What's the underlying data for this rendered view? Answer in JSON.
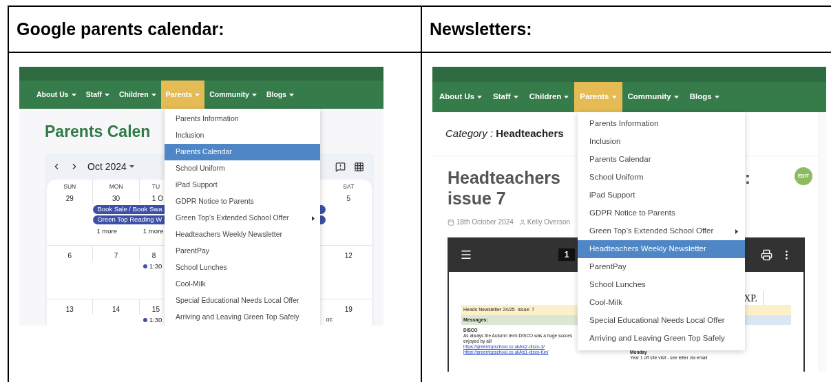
{
  "sections": [
    {
      "heading": "Google parents calendar:",
      "screenshot": {
        "kind": "calendar",
        "nav": [
          {
            "label": "About Us",
            "selected": false
          },
          {
            "label": "Staff",
            "selected": false
          },
          {
            "label": "Children",
            "selected": false
          },
          {
            "label": "Parents",
            "selected": true
          },
          {
            "label": "Community",
            "selected": false
          },
          {
            "label": "Blogs",
            "selected": false
          }
        ],
        "menu": [
          {
            "label": "Parents Information",
            "selected": false,
            "has_submenu": false
          },
          {
            "label": "Inclusion",
            "selected": false,
            "has_submenu": false
          },
          {
            "label": "Parents Calendar",
            "selected": true,
            "has_submenu": false
          },
          {
            "label": "School Uniform",
            "selected": false,
            "has_submenu": false
          },
          {
            "label": "iPad Support",
            "selected": false,
            "has_submenu": false
          },
          {
            "label": "GDPR Notice to Parents",
            "selected": false,
            "has_submenu": false
          },
          {
            "label": "Green Top’s Extended School Offer",
            "selected": false,
            "has_submenu": true
          },
          {
            "label": "Headteachers Weekly Newsletter",
            "selected": false,
            "has_submenu": false
          },
          {
            "label": "ParentPay",
            "selected": false,
            "has_submenu": false
          },
          {
            "label": "School Lunches",
            "selected": false,
            "has_submenu": false
          },
          {
            "label": "Cool-Milk",
            "selected": false,
            "has_submenu": false
          },
          {
            "label": "Special Educational Needs Local Offer",
            "selected": false,
            "has_submenu": false
          },
          {
            "label": "Arriving and Leaving Green Top Safely",
            "selected": false,
            "has_submenu": false
          }
        ],
        "page_title": "Parents Calen",
        "month": "Oct 2024",
        "weekdays": [
          "SUN",
          "MON",
          "TU",
          "SAT"
        ],
        "weeks": [
          {
            "days": [
              {
                "date": "29"
              },
              {
                "date": "30",
                "more": "1 more"
              },
              {
                "date": "1 O",
                "more": "1 more"
              },
              {
                "date": "5"
              }
            ],
            "all_day_events": [
              "Book Sale / Book Swa",
              "Green Top Reading W"
            ]
          },
          {
            "days": [
              {
                "date": "6"
              },
              {
                "date": "7"
              },
              {
                "date": "8",
                "timed_event": "1:30"
              },
              {
                "date": "12"
              }
            ]
          },
          {
            "days": [
              {
                "date": "13"
              },
              {
                "date": "14"
              },
              {
                "date": "15",
                "timed_event": "1:30"
              },
              {
                "date": "19"
              }
            ],
            "cut_event": "oc"
          }
        ]
      }
    },
    {
      "heading": "Newsletters:",
      "screenshot": {
        "kind": "post",
        "nav": [
          {
            "label": "About Us",
            "selected": false
          },
          {
            "label": "Staff",
            "selected": false
          },
          {
            "label": "Children",
            "selected": false
          },
          {
            "label": "Parents",
            "selected": true
          },
          {
            "label": "Community",
            "selected": false
          },
          {
            "label": "Blogs",
            "selected": false
          }
        ],
        "menu": [
          {
            "label": "Parents Information",
            "selected": false,
            "has_submenu": false
          },
          {
            "label": "Inclusion",
            "selected": false,
            "has_submenu": false
          },
          {
            "label": "Parents Calendar",
            "selected": false,
            "has_submenu": false
          },
          {
            "label": "School Uniform",
            "selected": false,
            "has_submenu": false
          },
          {
            "label": "iPad Support",
            "selected": false,
            "has_submenu": false
          },
          {
            "label": "GDPR Notice to Parents",
            "selected": false,
            "has_submenu": false
          },
          {
            "label": "Green Top’s Extended School Offer",
            "selected": false,
            "has_submenu": true
          },
          {
            "label": "Headteachers Weekly Newsletter",
            "selected": true,
            "has_submenu": false
          },
          {
            "label": "ParentPay",
            "selected": false,
            "has_submenu": false
          },
          {
            "label": "School Lunches",
            "selected": false,
            "has_submenu": false
          },
          {
            "label": "Cool-Milk",
            "selected": false,
            "has_submenu": false
          },
          {
            "label": "Special Educational Needs Local Offer",
            "selected": false,
            "has_submenu": false
          },
          {
            "label": "Arriving and Leaving Green Top Safely",
            "selected": false,
            "has_submenu": false
          }
        ],
        "category_label": "Category :",
        "category": "Headteachers",
        "title_lines": [
          "Headteachers",
          "issue 7"
        ],
        "title_fragment": ":",
        "edit_badge": "EDIT",
        "date": "18th October 2024",
        "author": "Kelly Overson",
        "viewer": {
          "page": "1",
          "document": {
            "logo": "XP.",
            "header": "Heads Newsletter 24/25  Issue: 7",
            "section": "Messages:",
            "item_title": "DISCO",
            "item_lines": [
              "As always the Autumn term DISCO was a huge succes",
              "enjoyed by all!"
            ],
            "links": [
              "https://greentopschool.co.uk/ks2-disco-3/",
              "https://greentopschool.co.uk/ks1-disco-fun/"
            ],
            "day": "Monday",
            "day_note": "Year 1 off site visit - see letter via email"
          }
        }
      }
    }
  ]
}
